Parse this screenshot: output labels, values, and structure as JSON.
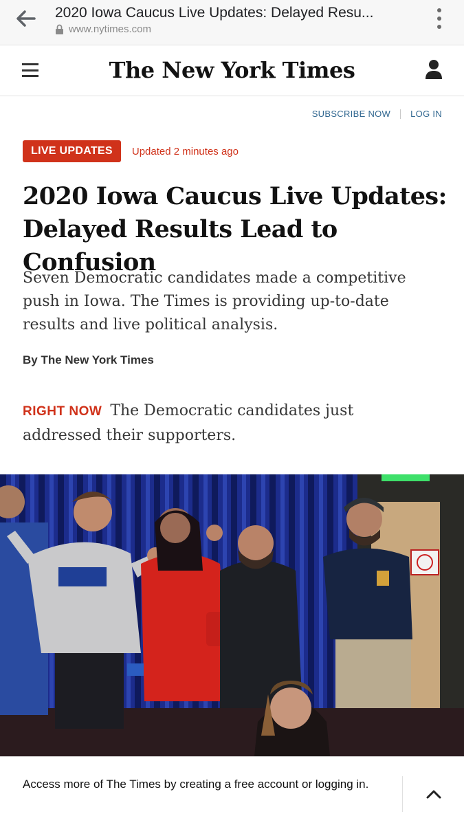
{
  "browser": {
    "page_title": "2020 Iowa Caucus Live Updates: Delayed Resu...",
    "url": "www.nytimes.com"
  },
  "masthead": {
    "logo_text": "The New York Times"
  },
  "auth": {
    "subscribe_label": "SUBSCRIBE NOW",
    "login_label": "LOG IN"
  },
  "article": {
    "badge": "LIVE UPDATES",
    "updated": "Updated 2 minutes ago",
    "headline": "2020 Iowa Caucus Live Updates: Delayed Results Lead to Confusion",
    "summary": "Seven Democratic candidates made a competitive push in Iowa. The Times is providing up-to-date results and live political analysis.",
    "byline": "By The New York Times",
    "right_now_label": "RIGHT NOW",
    "right_now_text": "The Democratic candidates just addressed their supporters."
  },
  "banner": {
    "text": "Access more of The Times by creating a free account or logging in."
  },
  "colors": {
    "accent_red": "#d0321a",
    "link_blue": "#326891"
  },
  "icons": {
    "back": "back-arrow-icon",
    "lock": "lock-icon",
    "more": "kebab-menu-icon",
    "menu": "hamburger-menu-icon",
    "account": "account-icon",
    "collapse": "chevron-up-icon"
  }
}
